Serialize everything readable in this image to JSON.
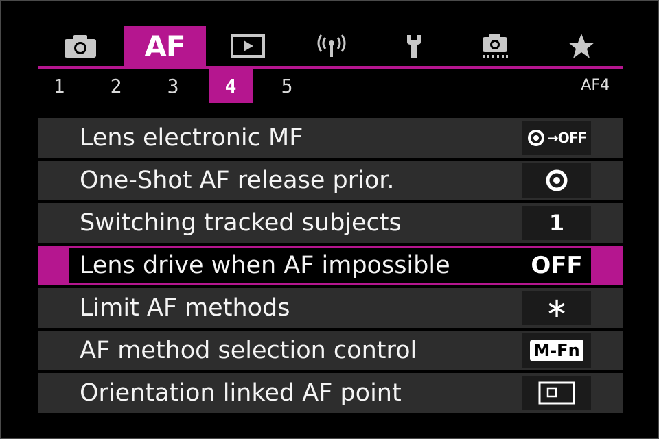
{
  "main_tabs": [
    {
      "name": "camera-tab",
      "icon": "camera-icon"
    },
    {
      "name": "af-tab",
      "label": "AF",
      "active": true
    },
    {
      "name": "playback-tab",
      "icon": "playback-icon"
    },
    {
      "name": "wireless-tab",
      "icon": "wireless-icon"
    },
    {
      "name": "setup-tab",
      "icon": "wrench-icon"
    },
    {
      "name": "custom-tab",
      "icon": "custom-camera-icon"
    },
    {
      "name": "my-menu-tab",
      "icon": "star-icon"
    }
  ],
  "sub_tabs": [
    "1",
    "2",
    "3",
    "4",
    "5"
  ],
  "active_sub_tab": "4",
  "page_code": "AF4",
  "menu": [
    {
      "label": "Lens electronic MF",
      "value": "→OFF",
      "icon": "focus-ring-icon"
    },
    {
      "label": "One-Shot AF release prior.",
      "value": "",
      "icon": "focus-ring-icon"
    },
    {
      "label": "Switching tracked subjects",
      "value": "1"
    },
    {
      "label": "Lens drive when AF impossible",
      "value": "OFF",
      "selected": true
    },
    {
      "label": "Limit AF methods",
      "value": "∗"
    },
    {
      "label": "AF method selection control",
      "value": "M-Fn"
    },
    {
      "label": "Orientation linked AF point",
      "value": "",
      "icon": "af-point-frame-icon"
    }
  ],
  "colors": {
    "accent": "#b5168f",
    "row_bg": "#2d2d2d",
    "background": "#000000"
  }
}
